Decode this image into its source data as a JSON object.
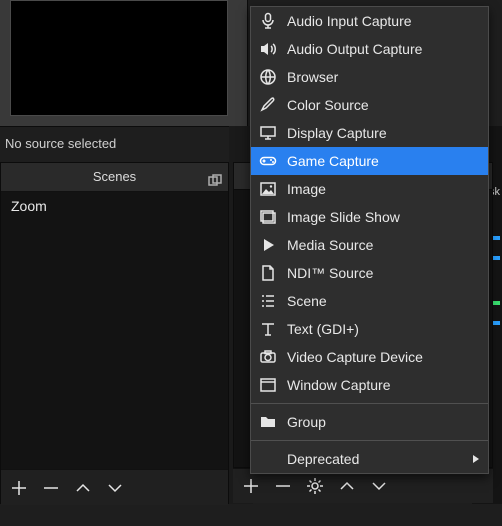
{
  "preview": {
    "status_text": "No source selected"
  },
  "scenes": {
    "header": "Scenes",
    "items": [
      "Zoom"
    ]
  },
  "sources_footer": {},
  "right_strip": {
    "label": "esk"
  },
  "menu": {
    "items": [
      {
        "icon": "mic-icon",
        "label": "Audio Input Capture"
      },
      {
        "icon": "speaker-icon",
        "label": "Audio Output Capture"
      },
      {
        "icon": "globe-icon",
        "label": "Browser"
      },
      {
        "icon": "brush-icon",
        "label": "Color Source"
      },
      {
        "icon": "monitor-icon",
        "label": "Display Capture"
      },
      {
        "icon": "gamepad-icon",
        "label": "Game Capture",
        "highlight": true
      },
      {
        "icon": "image-icon",
        "label": "Image"
      },
      {
        "icon": "slideshow-icon",
        "label": "Image Slide Show"
      },
      {
        "icon": "play-icon",
        "label": "Media Source"
      },
      {
        "icon": "document-icon",
        "label": "NDI™ Source"
      },
      {
        "icon": "list-icon",
        "label": "Scene"
      },
      {
        "icon": "text-icon",
        "label": "Text (GDI+)"
      },
      {
        "icon": "camera-icon",
        "label": "Video Capture Device"
      },
      {
        "icon": "window-icon",
        "label": "Window Capture"
      }
    ],
    "group_label": "Group",
    "deprecated_label": "Deprecated"
  }
}
